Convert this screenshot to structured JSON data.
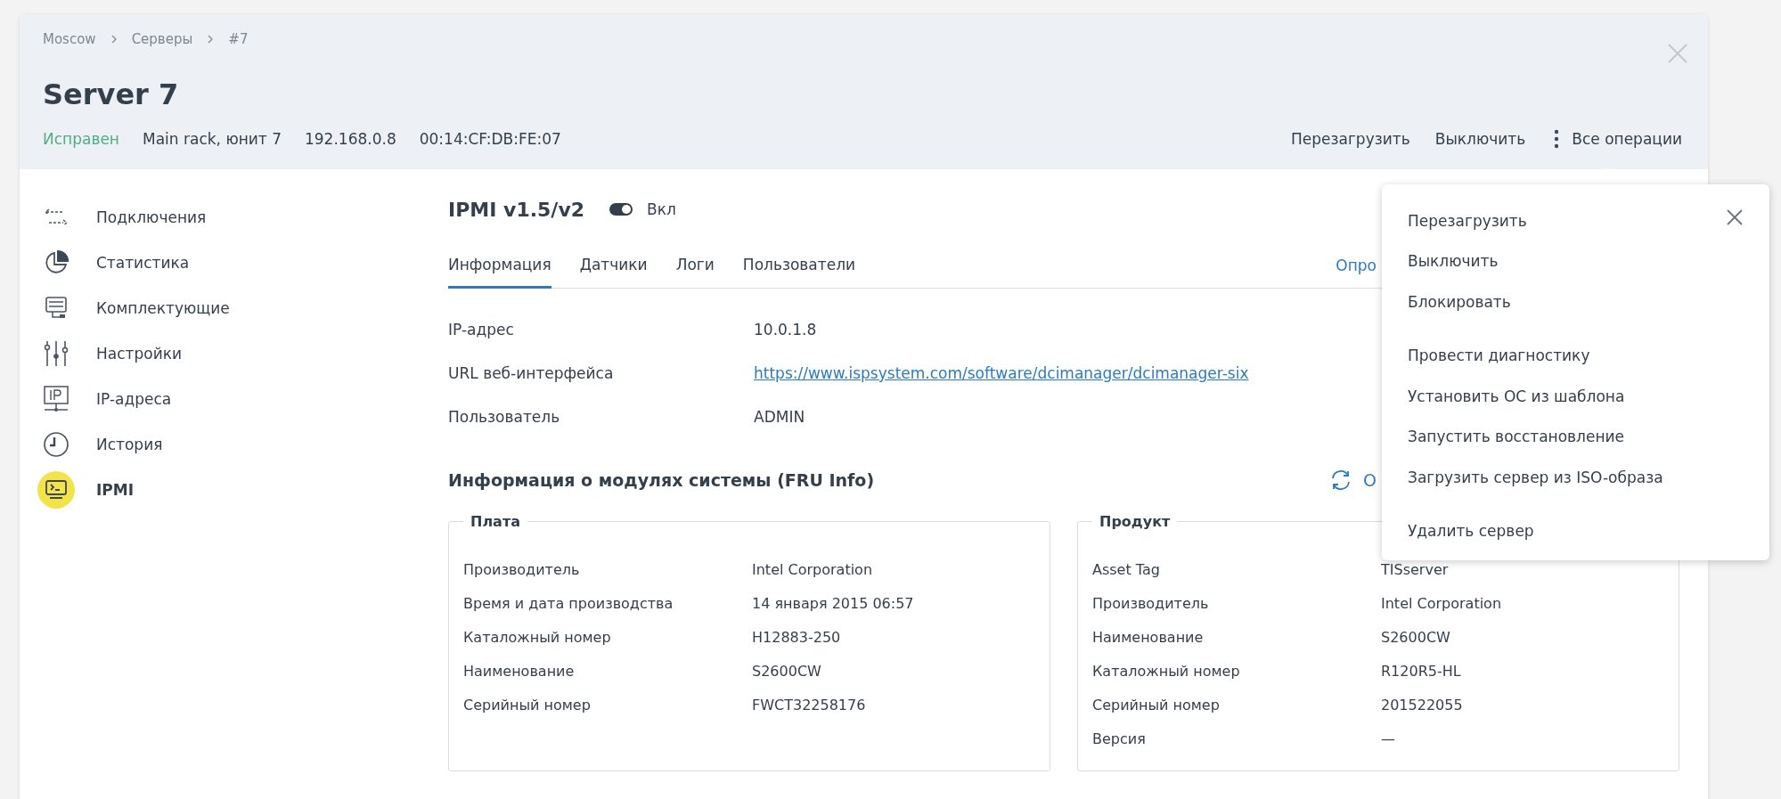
{
  "breadcrumbs": [
    "Moscow",
    "Серверы",
    "#7"
  ],
  "title": "Server 7",
  "meta": {
    "status": "Исправен",
    "location": "Main rack, юнит 7",
    "ip": "192.168.0.8",
    "mac": "00:14:CF:DB:FE:07"
  },
  "header_actions": [
    "Перезагрузить",
    "Выключить",
    "Все операции"
  ],
  "sidebar": {
    "items": [
      {
        "label": "Подключения",
        "kind": "connections",
        "selected": false
      },
      {
        "label": "Статистика",
        "kind": "statistics",
        "selected": false
      },
      {
        "label": "Комплектующие",
        "kind": "hardware",
        "selected": false
      },
      {
        "label": "Настройки",
        "kind": "settings",
        "selected": false
      },
      {
        "label": "IP-адреса",
        "kind": "addresses",
        "selected": false
      },
      {
        "label": "История",
        "kind": "history",
        "selected": false
      },
      {
        "label": "IPMI",
        "kind": "ipmi",
        "selected": true
      }
    ]
  },
  "ipmi": {
    "title": "IPMI v1.5/v2",
    "toggle": {
      "on": true,
      "label": "Вкл"
    },
    "tabs": [
      {
        "label": "Информация",
        "selected": true
      },
      {
        "label": "Датчики",
        "selected": false
      },
      {
        "label": "Логи",
        "selected": false
      },
      {
        "label": "Пользователи",
        "selected": false
      }
    ],
    "tabs_link": "Опро",
    "fields": [
      {
        "label": "IP-адрес",
        "value": "10.0.1.8",
        "kind": "text"
      },
      {
        "label": "URL веб-интерфейса",
        "value": "https://www.ispsystem.com/software/dcimanager/dcimanager-six",
        "kind": "link"
      },
      {
        "label": "Пользователь",
        "value": "ADMIN",
        "kind": "text"
      }
    ]
  },
  "fru": {
    "title": "Информация о модулях системы (FRU Info)",
    "refresh_label": "О",
    "groups": [
      {
        "title": "Плата",
        "rows": [
          {
            "label": "Производитель",
            "value": "Intel Corporation"
          },
          {
            "label": "Время и дата производства",
            "value": "14 января 2015 06:57"
          },
          {
            "label": "Каталожный номер",
            "value": "H12883-250"
          },
          {
            "label": "Наименование",
            "value": "S2600CW"
          },
          {
            "label": "Серийный номер",
            "value": "FWCT32258176"
          }
        ]
      },
      {
        "title": "Продукт",
        "rows": [
          {
            "label": "Asset Tag",
            "value": "TISserver"
          },
          {
            "label": "Производитель",
            "value": "Intel Corporation"
          },
          {
            "label": "Наименование",
            "value": "S2600CW"
          },
          {
            "label": "Каталожный номер",
            "value": "R120R5-HL"
          },
          {
            "label": "Серийный номер",
            "value": "201522055"
          },
          {
            "label": "Версия",
            "value": "—"
          }
        ]
      }
    ]
  },
  "operations_menu": {
    "groups": [
      [
        "Перезагрузить",
        "Выключить",
        "Блокировать"
      ],
      [
        "Провести диагностику",
        "Установить ОС из шаблона",
        "Запустить восстановление",
        "Загрузить сервер из ISO-образа"
      ],
      [
        "Удалить сервер"
      ]
    ]
  }
}
